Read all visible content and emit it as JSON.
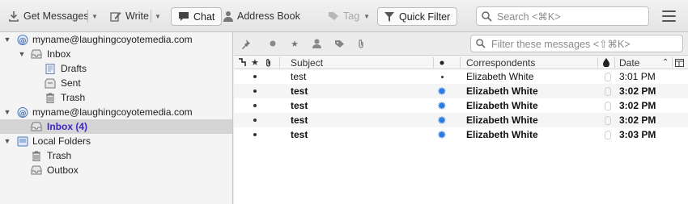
{
  "toolbar": {
    "get_messages": "Get Messages",
    "write": "Write",
    "chat": "Chat",
    "address_book": "Address Book",
    "tag": "Tag",
    "quick_filter": "Quick Filter",
    "search_placeholder": "Search <⌘K>"
  },
  "folders": {
    "account1": "myname@laughingcoyotemedia.com",
    "inbox1": "Inbox",
    "drafts": "Drafts",
    "sent": "Sent",
    "trash1": "Trash",
    "account2": "myname@laughingcoyotemedia.com",
    "inbox2": "Inbox (4)",
    "local": "Local Folders",
    "trash2": "Trash",
    "outbox": "Outbox"
  },
  "quickfilter": {
    "placeholder": "Filter these messages <⇧⌘K>"
  },
  "columns": {
    "subject": "Subject",
    "correspondents": "Correspondents",
    "date": "Date"
  },
  "messages": [
    {
      "subject": "test",
      "from": "Elizabeth White",
      "date": "3:01 PM",
      "unread": false
    },
    {
      "subject": "test",
      "from": "Elizabeth White",
      "date": "3:02 PM",
      "unread": true
    },
    {
      "subject": "test",
      "from": "Elizabeth White",
      "date": "3:02 PM",
      "unread": true
    },
    {
      "subject": "test",
      "from": "Elizabeth White",
      "date": "3:02 PM",
      "unread": true
    },
    {
      "subject": "test",
      "from": "Elizabeth White",
      "date": "3:03 PM",
      "unread": true
    }
  ],
  "colors": {
    "selected_folder_text": "#3d25c8",
    "unread_star": "#2a7be4"
  }
}
